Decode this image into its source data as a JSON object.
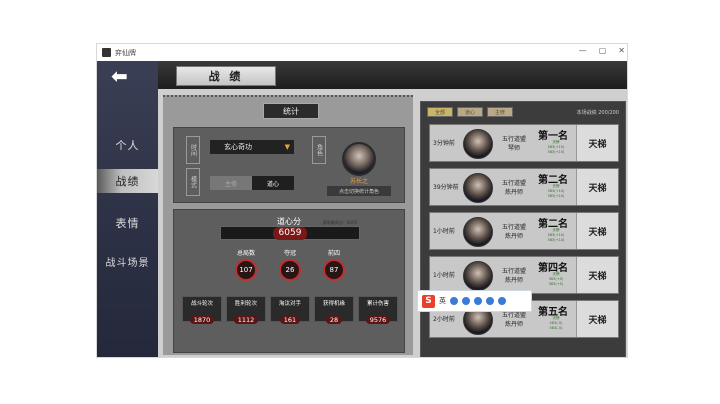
{
  "window": {
    "title": "弈仙牌",
    "controls": [
      "—",
      "▢",
      "✕"
    ]
  },
  "sidebar": {
    "back_glyph": "⬅",
    "items": [
      {
        "label": "个人",
        "active": false
      },
      {
        "label": "战绩",
        "active": true
      },
      {
        "label": "表情",
        "active": false
      },
      {
        "label": "战斗场景",
        "active": false
      }
    ]
  },
  "header": {
    "title": "战 绩"
  },
  "stats": {
    "title": "统计",
    "filter": {
      "time_label": "时间",
      "period_value": "玄心奇功",
      "mode_label": "模式",
      "mode_options": [
        "主修",
        "道心"
      ],
      "mode_selected": "道心",
      "role_label": "角色",
      "char_name": "苏长之",
      "char_button": "点击切换统计角色"
    },
    "score": {
      "label": "道心分",
      "value": "6059",
      "note": "赛季最高分：6059"
    },
    "circles": [
      {
        "label": "总局数",
        "value": "107"
      },
      {
        "label": "夺冠",
        "value": "26"
      },
      {
        "label": "前四",
        "value": "87"
      }
    ],
    "cells": [
      {
        "label": "战斗轮次",
        "value": "1870"
      },
      {
        "label": "胜利轮次",
        "value": "1112"
      },
      {
        "label": "淘汰对手",
        "value": "161"
      },
      {
        "label": "获得机缘",
        "value": "28"
      },
      {
        "label": "累计伤害",
        "value": "9576"
      }
    ]
  },
  "history": {
    "tabs": [
      "全部",
      "道心",
      "主修"
    ],
    "rank_info": "本场战绩 200/200",
    "rows": [
      {
        "time": "3分钟前",
        "name": "五行道盟\n琴师",
        "place": "第一名",
        "mode": "天梯",
        "mini": "天榜\n583(+15)\n583(+15)"
      },
      {
        "time": "39分钟前",
        "name": "五行道盟\n炼丹师",
        "place": "第二名",
        "mode": "天梯",
        "mini": "天榜\n583(+10)\n583(+10)"
      },
      {
        "time": "1小时前",
        "name": "五行道盟\n炼丹师",
        "place": "第二名",
        "mode": "天梯",
        "mini": "天榜\n583(+10)\n583(+10)"
      },
      {
        "time": "1小时前",
        "name": "五行道盟\n炼丹师",
        "place": "第四名",
        "mode": "天梯",
        "mini": "天榜\n583(+5)\n583(+5)"
      },
      {
        "time": "2小时前",
        "name": "五行道盟\n炼丹师",
        "place": "第五名",
        "mode": "天梯",
        "mini": "天榜\n583(-5)\n583(-5)"
      }
    ]
  },
  "ime": {
    "badge": "S",
    "lang": "英"
  }
}
